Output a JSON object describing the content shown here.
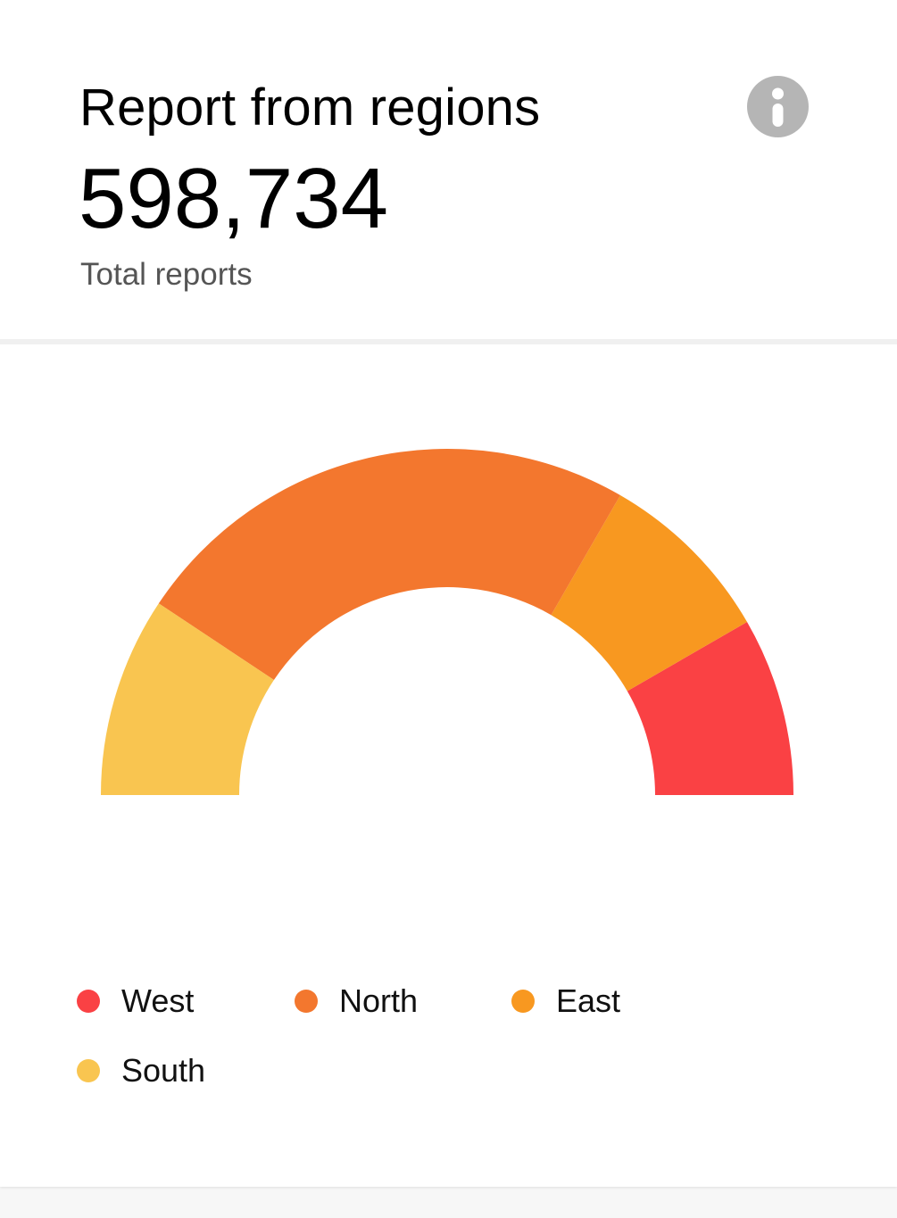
{
  "header": {
    "title": "Report from regions",
    "total": "598,734",
    "subtitle": "Total reports",
    "info_icon": "info-icon"
  },
  "chart_data": {
    "type": "pie",
    "variant": "semi-donut",
    "segments_order": "right-to-left",
    "series": [
      {
        "name": "West",
        "value": 12.5,
        "color": "#fa4144"
      },
      {
        "name": "East",
        "value": 12.5,
        "color": "#f89820"
      },
      {
        "name": "North",
        "value": 36,
        "color": "#f3772e"
      },
      {
        "name": "South",
        "value": 14,
        "color": "#f9c550"
      }
    ]
  },
  "legend": {
    "items": [
      {
        "label": "West",
        "color": "#fa4144"
      },
      {
        "label": "North",
        "color": "#f3772e"
      },
      {
        "label": "East",
        "color": "#f89820"
      },
      {
        "label": "South",
        "color": "#f9c550"
      }
    ]
  },
  "colors": {
    "icon_bg": "#b5b5b5",
    "divider": "#f0f0f0"
  }
}
